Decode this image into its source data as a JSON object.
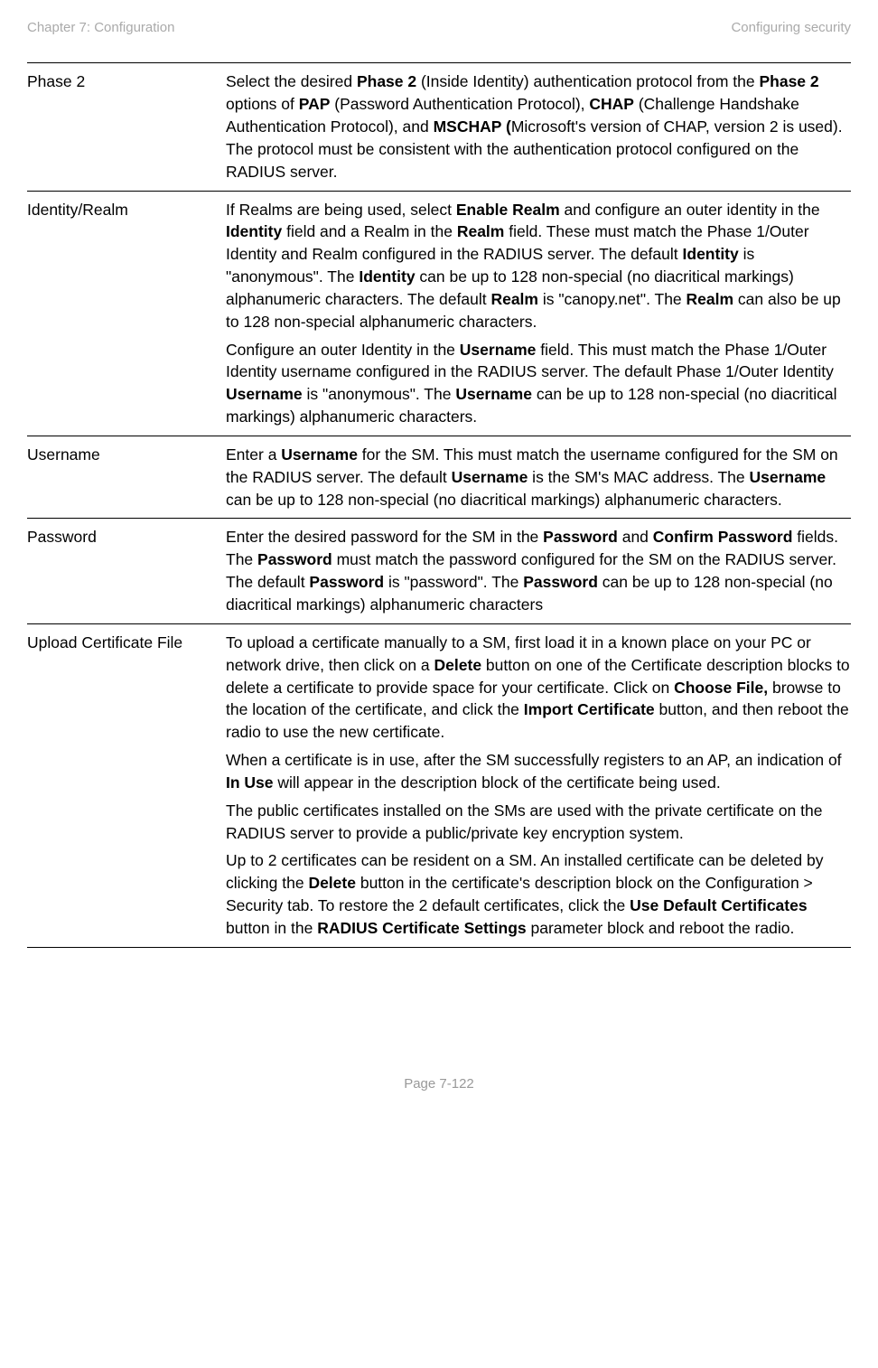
{
  "header": {
    "left": "Chapter 7:  Configuration",
    "right": "Configuring security"
  },
  "rows": [
    {
      "attr": "Phase 2",
      "paragraphs": [
        "Select the desired <b>Phase 2</b> (Inside Identity) authentication protocol from the <b>Phase 2</b> options of <b>PAP</b> (Password Authentication Protocol), <b>CHAP</b> (Challenge Handshake Authentication Protocol), and <b>MSCHAP (</b>Microsoft's version of CHAP, version 2 is used). The protocol must be consistent with the authentication protocol configured on the RADIUS server."
      ]
    },
    {
      "attr": "Identity/Realm",
      "paragraphs": [
        "If Realms are being used, select <b>Enable Realm</b> and configure an outer identity in the <b>Identity</b> field and a Realm in the <b>Realm</b> field. These must match the Phase 1/Outer Identity and Realm configured in the RADIUS server. The default <b>Identity</b> is \"anonymous\". The <b>Identity</b> can be up to 128 non-special (no diacritical markings) alphanumeric characters. The default <b>Realm</b> is \"canopy.net\". The <b>Realm</b> can also be up to 128 non-special alphanumeric characters.",
        "Configure an outer Identity in the <b>Username</b> field. This must match the Phase 1/Outer Identity username configured in the RADIUS server. The default Phase 1/Outer Identity <b>Username</b> is \"anonymous\". The <b>Username</b> can be up to 128 non-special (no diacritical markings) alphanumeric characters."
      ]
    },
    {
      "attr": "Username",
      "paragraphs": [
        "Enter a <b>Username</b> for the SM. This must match the username configured for the SM on the RADIUS server. The default <b>Username</b> is the SM's MAC address. The <b>Username</b> can be up to 128 non-special (no diacritical markings) alphanumeric characters."
      ]
    },
    {
      "attr": "Password",
      "paragraphs": [
        "Enter the desired password for the SM in the <b>Password</b> and <b>Confirm Password</b> fields. The <b>Password</b> must match the password configured for the SM on the RADIUS server. The default <b>Password</b> is \"password\". The <b>Password</b> can be up to 128 non-special (no diacritical markings) alphanumeric characters"
      ]
    },
    {
      "attr": "Upload Certificate File",
      "paragraphs": [
        "To upload a certificate manually to a SM, first load it in a known place on your PC or network drive, then click on a <b>Delete</b> button on one of the Certificate description blocks to delete a certificate to provide space for your certificate. Click on <b>Choose File,</b> browse to the location of the certificate, and click the <b>Import Certificate</b> button, and then reboot the radio to use the new certificate.",
        "When a certificate is in use, after the SM successfully registers to an AP, an indication of <b>In Use</b> will appear in the description block of the certificate being used.",
        "The public certificates installed on the SMs are used with the private certificate on the RADIUS server to provide a public/private key encryption system.",
        "Up to 2 certificates can be resident on a SM. An installed certificate can be deleted by clicking the <b>Delete</b> button in the certificate's description block on the Configuration > Security tab. To restore the 2 default certificates, click the <b>Use Default Certificates</b> button in the <b>RADIUS Certificate Settings</b> parameter block and reboot the radio."
      ]
    }
  ],
  "footer": "Page 7-122"
}
